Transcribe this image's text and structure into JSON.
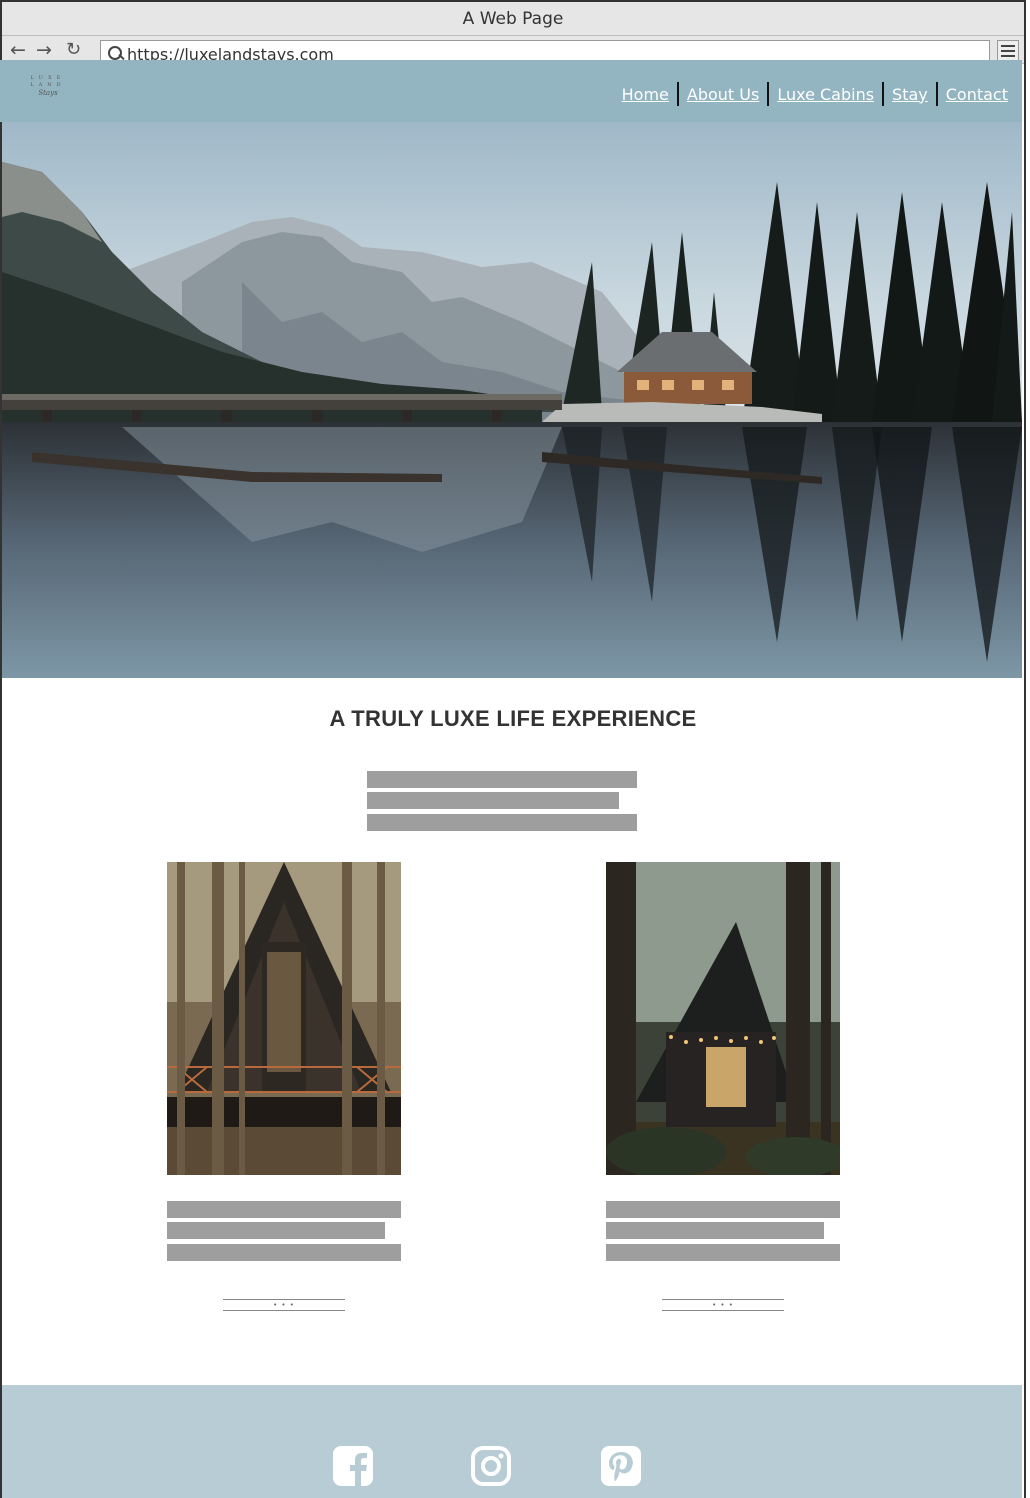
{
  "browser": {
    "window_title": "A Web Page",
    "url": "https://luxelandstays.com",
    "back_icon": "←",
    "forward_icon": "→",
    "reload_icon": "↻"
  },
  "site": {
    "logo": {
      "line1": "LUXE",
      "line2": "LAND",
      "script": "Stays"
    },
    "nav": [
      "Home",
      "About Us",
      "Luxe Cabins",
      "Stay",
      "Contact"
    ],
    "headline": "A TRULY LUXE LIFE EXPERIENCE",
    "more_button_glyph": "• • •"
  },
  "colors": {
    "header_bg": "#93b4c1",
    "footer_bg": "#b7ccd4",
    "placeholder_text": "#9e9e9e"
  },
  "footer": {
    "icons": [
      "facebook-icon",
      "instagram-icon",
      "pinterest-icon"
    ]
  }
}
